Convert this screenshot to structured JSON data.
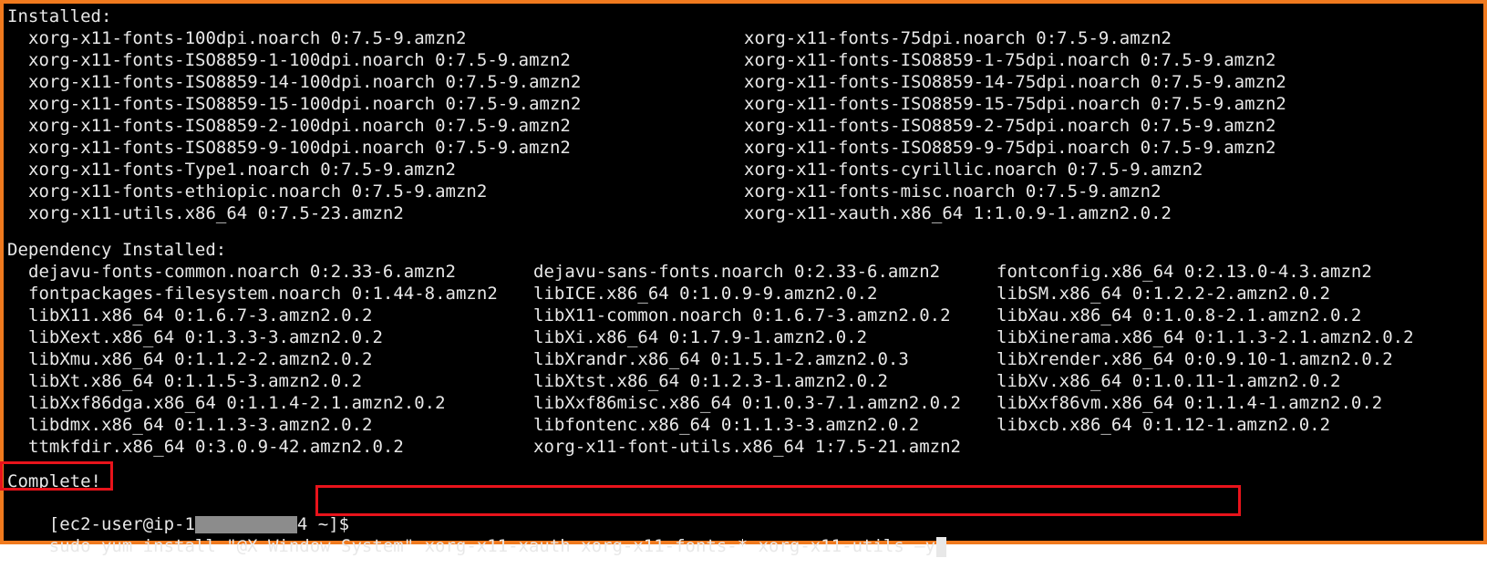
{
  "terminal": {
    "installed_header": "Installed:",
    "installed_left": [
      "xorg-x11-fonts-100dpi.noarch 0:7.5-9.amzn2",
      "xorg-x11-fonts-ISO8859-1-100dpi.noarch 0:7.5-9.amzn2",
      "xorg-x11-fonts-ISO8859-14-100dpi.noarch 0:7.5-9.amzn2",
      "xorg-x11-fonts-ISO8859-15-100dpi.noarch 0:7.5-9.amzn2",
      "xorg-x11-fonts-ISO8859-2-100dpi.noarch 0:7.5-9.amzn2",
      "xorg-x11-fonts-ISO8859-9-100dpi.noarch 0:7.5-9.amzn2",
      "xorg-x11-fonts-Type1.noarch 0:7.5-9.amzn2",
      "xorg-x11-fonts-ethiopic.noarch 0:7.5-9.amzn2",
      "xorg-x11-utils.x86_64 0:7.5-23.amzn2"
    ],
    "installed_right": [
      "xorg-x11-fonts-75dpi.noarch 0:7.5-9.amzn2",
      "xorg-x11-fonts-ISO8859-1-75dpi.noarch 0:7.5-9.amzn2",
      "xorg-x11-fonts-ISO8859-14-75dpi.noarch 0:7.5-9.amzn2",
      "xorg-x11-fonts-ISO8859-15-75dpi.noarch 0:7.5-9.amzn2",
      "xorg-x11-fonts-ISO8859-2-75dpi.noarch 0:7.5-9.amzn2",
      "xorg-x11-fonts-ISO8859-9-75dpi.noarch 0:7.5-9.amzn2",
      "xorg-x11-fonts-cyrillic.noarch 0:7.5-9.amzn2",
      "xorg-x11-fonts-misc.noarch 0:7.5-9.amzn2",
      "xorg-x11-xauth.x86_64 1:1.0.9-1.amzn2.0.2"
    ],
    "dependency_header": "Dependency Installed:",
    "dep_col1": [
      "dejavu-fonts-common.noarch 0:2.33-6.amzn2",
      "fontpackages-filesystem.noarch 0:1.44-8.amzn2",
      "libX11.x86_64 0:1.6.7-3.amzn2.0.2",
      "libXext.x86_64 0:1.3.3-3.amzn2.0.2",
      "libXmu.x86_64 0:1.1.2-2.amzn2.0.2",
      "libXt.x86_64 0:1.1.5-3.amzn2.0.2",
      "libXxf86dga.x86_64 0:1.1.4-2.1.amzn2.0.2",
      "libdmx.x86_64 0:1.1.3-3.amzn2.0.2",
      "ttmkfdir.x86_64 0:3.0.9-42.amzn2.0.2"
    ],
    "dep_col2": [
      "dejavu-sans-fonts.noarch 0:2.33-6.amzn2",
      "libICE.x86_64 0:1.0.9-9.amzn2.0.2",
      "libX11-common.noarch 0:1.6.7-3.amzn2.0.2",
      "libXi.x86_64 0:1.7.9-1.amzn2.0.2",
      "libXrandr.x86_64 0:1.5.1-2.amzn2.0.3",
      "libXtst.x86_64 0:1.2.3-1.amzn2.0.2",
      "libXxf86misc.x86_64 0:1.0.3-7.1.amzn2.0.2",
      "libfontenc.x86_64 0:1.1.3-3.amzn2.0.2",
      "xorg-x11-font-utils.x86_64 1:7.5-21.amzn2"
    ],
    "dep_col3": [
      "fontconfig.x86_64 0:2.13.0-4.3.amzn2",
      "libSM.x86_64 0:1.2.2-2.amzn2.0.2",
      "libXau.x86_64 0:1.0.8-2.1.amzn2.0.2",
      "libXinerama.x86_64 0:1.1.3-2.1.amzn2.0.2",
      "libXrender.x86_64 0:0.9.10-1.amzn2.0.2",
      "libXv.x86_64 0:1.0.11-1.amzn2.0.2",
      "libXxf86vm.x86_64 0:1.1.4-1.amzn2.0.2",
      "libxcb.x86_64 0:1.12-1.amzn2.0.2"
    ],
    "complete_text": "Complete!",
    "prompt_prefix": "[ec2-user@ip-1",
    "prompt_suffix": "4 ~]$",
    "command": "sudo yum install \"@X Window System\" xorg-x11-xauth xorg-x11-fonts-* xorg-x11-utils –y",
    "colors": {
      "background": "#000000",
      "text": "#e8e8e8",
      "frame": "#f07a1e",
      "highlight": "#e8131b"
    }
  }
}
